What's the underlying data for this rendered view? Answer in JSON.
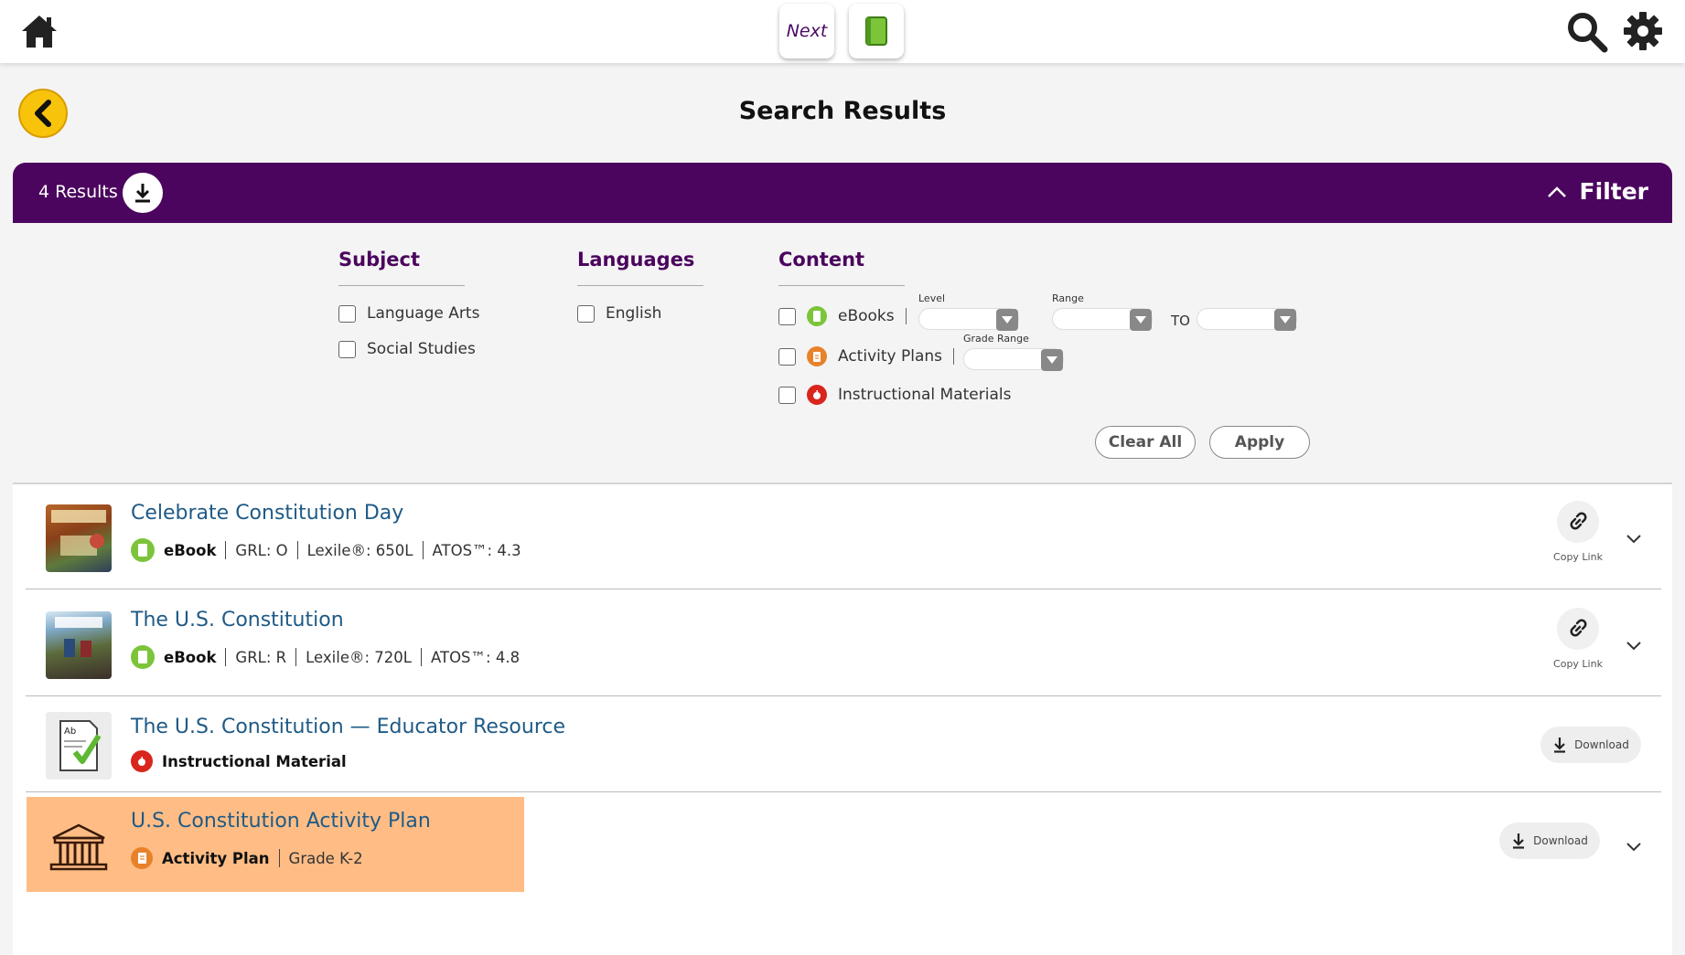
{
  "topbar": {
    "home_icon": "home-icon",
    "next_label": "Next",
    "book_icon": "green-book-icon",
    "search_icon": "search-icon",
    "settings_icon": "gear-icon"
  },
  "page": {
    "back_icon": "chevron-left-icon",
    "title": "Search Results"
  },
  "results_bar": {
    "count_label": "4 Results",
    "download_icon": "download-icon",
    "filter_label": "Filter",
    "filter_icon": "chevron-up-icon",
    "bar_color": "#4b055e"
  },
  "filters": {
    "subject": {
      "heading": "Subject",
      "options": [
        "Language Arts",
        "Social Studies"
      ]
    },
    "languages": {
      "heading": "Languages",
      "options": [
        "English"
      ]
    },
    "content": {
      "heading": "Content",
      "ebooks_label": "eBooks",
      "level_label": "Level",
      "range_label": "Range",
      "to_label": "TO",
      "activity_plans_label": "Activity Plans",
      "grade_range_label": "Grade Range",
      "instructional_label": "Instructional Materials"
    },
    "clear_all_label": "Clear All",
    "apply_label": "Apply"
  },
  "results": [
    {
      "title": "Celebrate Constitution Day",
      "type": "eBook",
      "grl": "GRL: O",
      "lexile": "Lexile®: 650L",
      "atos": "ATOS™: 4.3",
      "action_label": "Copy Link"
    },
    {
      "title": "The U.S. Constitution",
      "type": "eBook",
      "grl": "GRL: R",
      "lexile": "Lexile®: 720L",
      "atos": "ATOS™: 4.8",
      "action_label": "Copy Link"
    },
    {
      "title": "The U.S. Constitution — Educator Resource",
      "type": "Instructional Material",
      "action_label": "Download"
    },
    {
      "title": "U.S. Constitution Activity Plan",
      "type": "Activity Plan",
      "grade": "Grade K-2",
      "action_label": "Download"
    }
  ],
  "colors": {
    "ebook_green": "#7cc43a",
    "activity_orange": "#e8822a",
    "instructional_red": "#d9251d",
    "title_blue": "#1f5a86",
    "highlight": "#ffbd85",
    "back_yellow": "#f8c30b"
  }
}
